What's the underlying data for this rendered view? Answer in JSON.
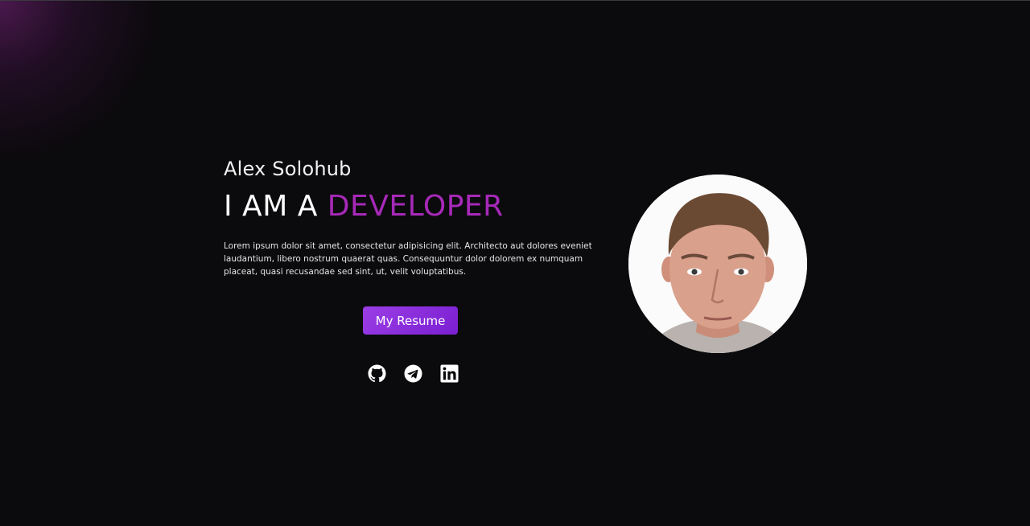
{
  "hero": {
    "name": "Alex Solohub",
    "headline_prefix": "I AM A ",
    "headline_accent": "DEVELOPER",
    "bio": "Lorem ipsum dolor sit amet, consectetur adipisicing elit. Architecto aut dolores eveniet laudantium, libero nostrum quaerat quas. Consequuntur dolor dolorem ex numquam placeat, quasi recusandae sed sint, ut, velit voluptatibus.",
    "resume_button": "My Resume"
  },
  "socials": [
    {
      "icon": "github-icon"
    },
    {
      "icon": "telegram-icon"
    },
    {
      "icon": "linkedin-icon"
    }
  ],
  "avatar": {
    "icon": "profile-photo"
  },
  "colors": {
    "background": "#0b0a0c",
    "accent": "#a629b8",
    "button_start": "#9b3ee6",
    "button_end": "#7a1fd1",
    "glow": "#7e2482"
  }
}
